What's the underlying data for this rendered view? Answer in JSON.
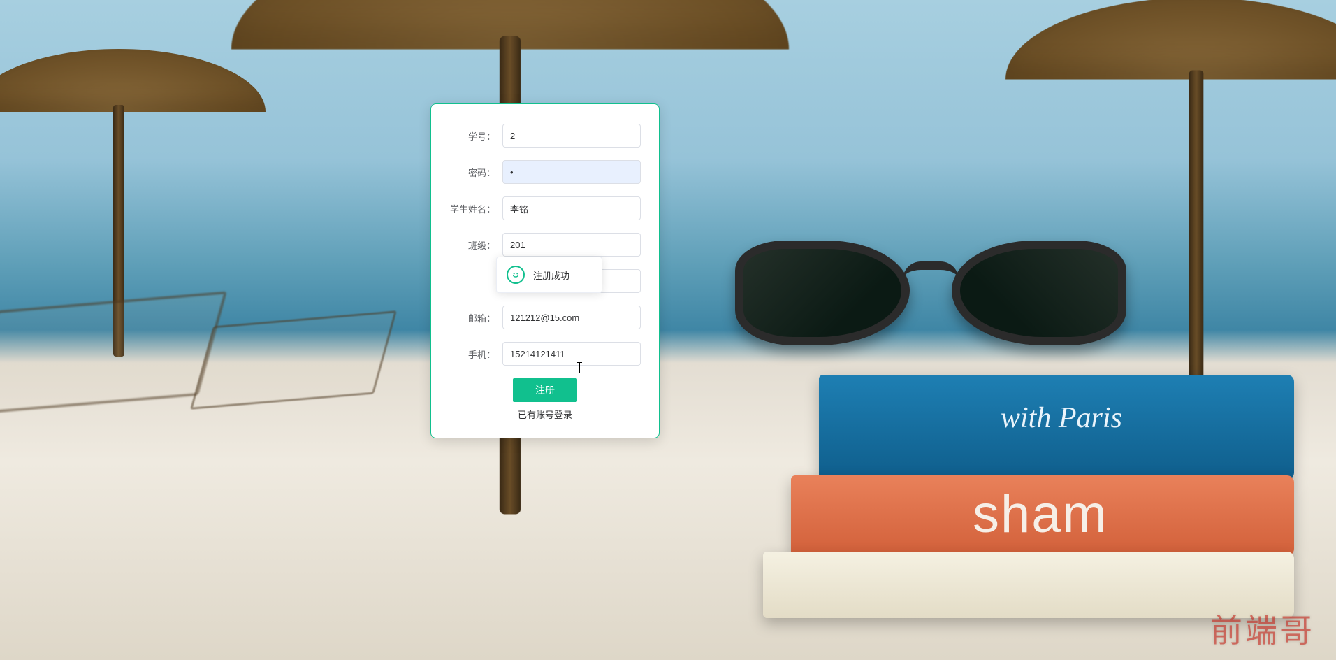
{
  "form": {
    "fields": {
      "student_id": {
        "label": "学号：",
        "value": "2"
      },
      "password": {
        "label": "密码：",
        "value": "•"
      },
      "name": {
        "label": "学生姓名：",
        "value": "李铭"
      },
      "class": {
        "label": "班级：",
        "value": "201"
      },
      "hidden": {
        "label": "",
        "value": ""
      },
      "email": {
        "label": "邮箱：",
        "value": "121212@15.com"
      },
      "phone": {
        "label": "手机：",
        "value": "15214121411"
      }
    },
    "submit_label": "注册",
    "login_link_label": "已有账号登录"
  },
  "toast": {
    "text": "注册成功"
  },
  "watermark": "前端哥"
}
